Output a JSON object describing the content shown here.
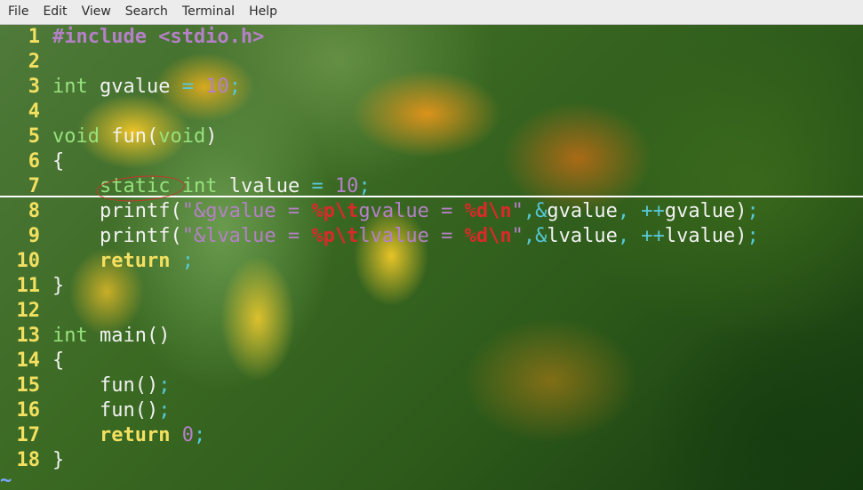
{
  "menubar": {
    "items": [
      "File",
      "Edit",
      "View",
      "Search",
      "Terminal",
      "Help"
    ]
  },
  "editor": {
    "cursor_line": 7,
    "annotation": "circled keyword: static",
    "empty_marker": "~",
    "lines": [
      {
        "num": "1",
        "tokens": [
          {
            "t": "#include <stdio.h>",
            "c": "preproc"
          }
        ]
      },
      {
        "num": "2",
        "tokens": []
      },
      {
        "num": "3",
        "tokens": [
          {
            "t": "int",
            "c": "type"
          },
          {
            "t": " gvalue ",
            "c": "plain"
          },
          {
            "t": "=",
            "c": "op"
          },
          {
            "t": " 10",
            "c": "number"
          },
          {
            "t": ";",
            "c": "op"
          }
        ]
      },
      {
        "num": "4",
        "tokens": []
      },
      {
        "num": "5",
        "tokens": [
          {
            "t": "void",
            "c": "type"
          },
          {
            "t": " fun(",
            "c": "plain"
          },
          {
            "t": "void",
            "c": "type"
          },
          {
            "t": ")",
            "c": "plain"
          }
        ]
      },
      {
        "num": "6",
        "tokens": [
          {
            "t": "{",
            "c": "plain"
          }
        ]
      },
      {
        "num": "7",
        "tokens": [
          {
            "t": "    ",
            "c": "plain"
          },
          {
            "t": "static",
            "c": "type"
          },
          {
            "t": " ",
            "c": "plain"
          },
          {
            "t": "int",
            "c": "type"
          },
          {
            "t": " lvalue ",
            "c": "plain"
          },
          {
            "t": "=",
            "c": "op"
          },
          {
            "t": " 10",
            "c": "number"
          },
          {
            "t": ";",
            "c": "op"
          }
        ]
      },
      {
        "num": "8",
        "tokens": [
          {
            "t": "    printf(",
            "c": "plain"
          },
          {
            "t": "\"&gvalue = ",
            "c": "string"
          },
          {
            "t": "%p\\t",
            "c": "fmt"
          },
          {
            "t": "gvalue = ",
            "c": "string"
          },
          {
            "t": "%d\\n",
            "c": "fmt"
          },
          {
            "t": "\"",
            "c": "string"
          },
          {
            "t": ",",
            "c": "op"
          },
          {
            "t": "&",
            "c": "op"
          },
          {
            "t": "gvalue",
            "c": "plain"
          },
          {
            "t": ",",
            "c": "op"
          },
          {
            "t": " ",
            "c": "plain"
          },
          {
            "t": "++",
            "c": "op"
          },
          {
            "t": "gvalue)",
            "c": "plain"
          },
          {
            "t": ";",
            "c": "op"
          }
        ]
      },
      {
        "num": "9",
        "tokens": [
          {
            "t": "    printf(",
            "c": "plain"
          },
          {
            "t": "\"&lvalue = ",
            "c": "string"
          },
          {
            "t": "%p\\t",
            "c": "fmt"
          },
          {
            "t": "lvalue = ",
            "c": "string"
          },
          {
            "t": "%d\\n",
            "c": "fmt"
          },
          {
            "t": "\"",
            "c": "string"
          },
          {
            "t": ",",
            "c": "op"
          },
          {
            "t": "&",
            "c": "op"
          },
          {
            "t": "lvalue",
            "c": "plain"
          },
          {
            "t": ",",
            "c": "op"
          },
          {
            "t": " ",
            "c": "plain"
          },
          {
            "t": "++",
            "c": "op"
          },
          {
            "t": "lvalue)",
            "c": "plain"
          },
          {
            "t": ";",
            "c": "op"
          }
        ]
      },
      {
        "num": "10",
        "tokens": [
          {
            "t": "    ",
            "c": "plain"
          },
          {
            "t": "return",
            "c": "kw"
          },
          {
            "t": " ",
            "c": "plain"
          },
          {
            "t": ";",
            "c": "op"
          }
        ]
      },
      {
        "num": "11",
        "tokens": [
          {
            "t": "}",
            "c": "plain"
          }
        ]
      },
      {
        "num": "12",
        "tokens": []
      },
      {
        "num": "13",
        "tokens": [
          {
            "t": "int",
            "c": "type"
          },
          {
            "t": " main()",
            "c": "plain"
          }
        ]
      },
      {
        "num": "14",
        "tokens": [
          {
            "t": "{",
            "c": "plain"
          }
        ]
      },
      {
        "num": "15",
        "tokens": [
          {
            "t": "    fun()",
            "c": "plain"
          },
          {
            "t": ";",
            "c": "op"
          }
        ]
      },
      {
        "num": "16",
        "tokens": [
          {
            "t": "    fun()",
            "c": "plain"
          },
          {
            "t": ";",
            "c": "op"
          }
        ]
      },
      {
        "num": "17",
        "tokens": [
          {
            "t": "    ",
            "c": "plain"
          },
          {
            "t": "return",
            "c": "kw"
          },
          {
            "t": " 0",
            "c": "number"
          },
          {
            "t": ";",
            "c": "op"
          }
        ]
      },
      {
        "num": "18",
        "tokens": [
          {
            "t": "}",
            "c": "plain"
          }
        ]
      }
    ]
  },
  "colors": {
    "line_number": "#f4e060",
    "type": "#98e27e",
    "preproc": "#b480c6",
    "operator": "#56c8d8",
    "keyword": "#f4e060",
    "format_specifier": "#d92a2a",
    "annotation": "#c0392b"
  }
}
